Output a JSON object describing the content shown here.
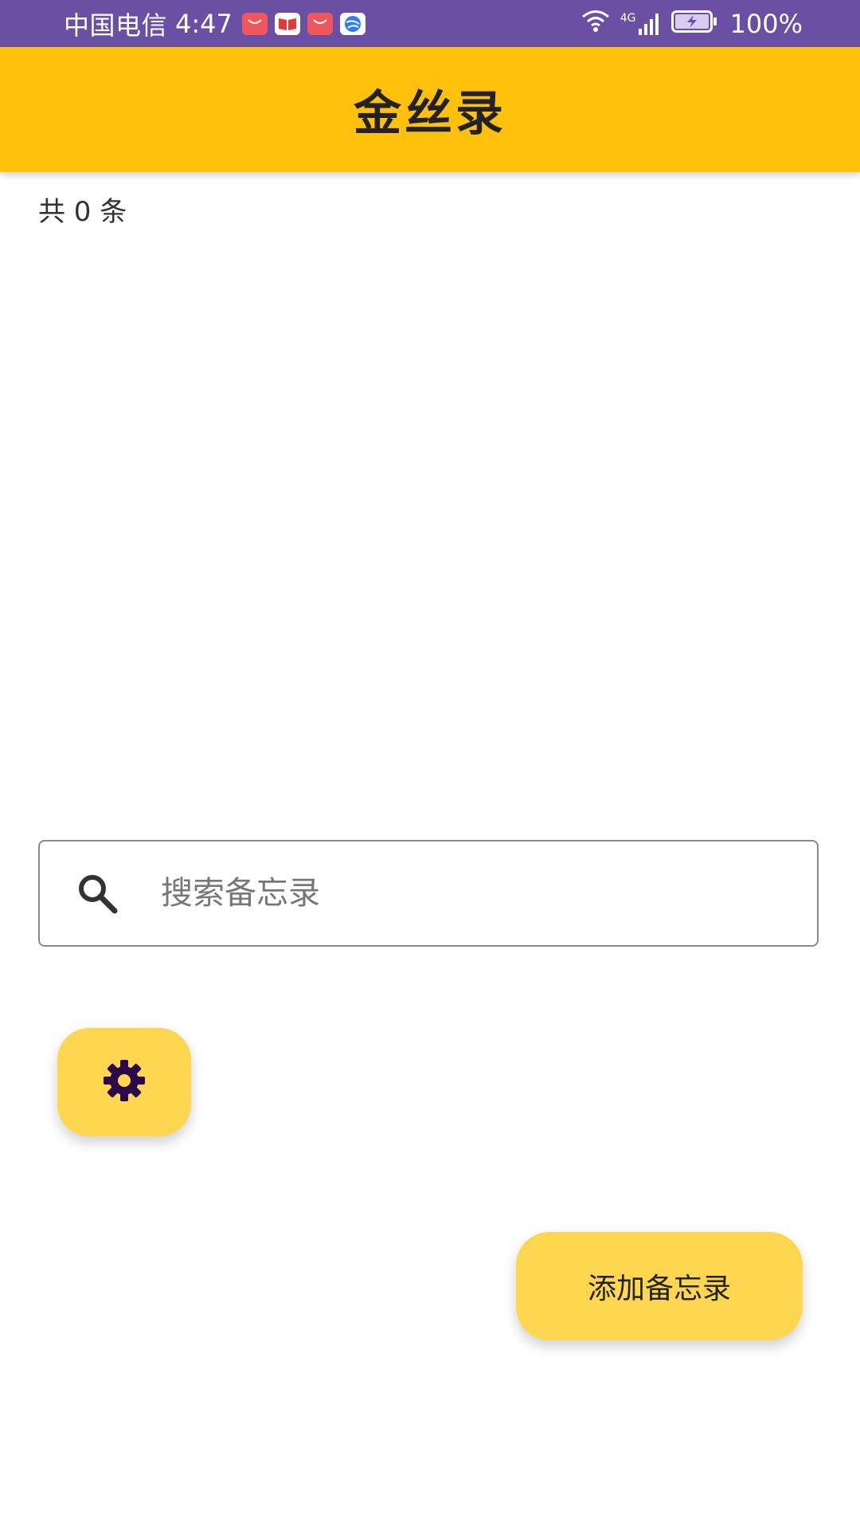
{
  "status_bar": {
    "carrier": "中国电信",
    "time": "4:47",
    "network": "4G",
    "battery": "100%",
    "notification_icons": [
      "huawei-appgallery-icon",
      "book-icon",
      "huawei-appgallery-icon",
      "browser-icon"
    ],
    "background": "#6a50a4"
  },
  "app_bar": {
    "title": "金丝录",
    "background": "#ffc10c"
  },
  "summary": {
    "count_text": "共 0 条"
  },
  "search": {
    "placeholder": "搜索备忘录",
    "value": "",
    "icon": "search-icon"
  },
  "settings_button": {
    "icon": "gear-icon",
    "background": "#ffd64f",
    "icon_color": "#2a0a4a"
  },
  "add_button": {
    "label": "添加备忘录",
    "background": "#ffd64f"
  }
}
